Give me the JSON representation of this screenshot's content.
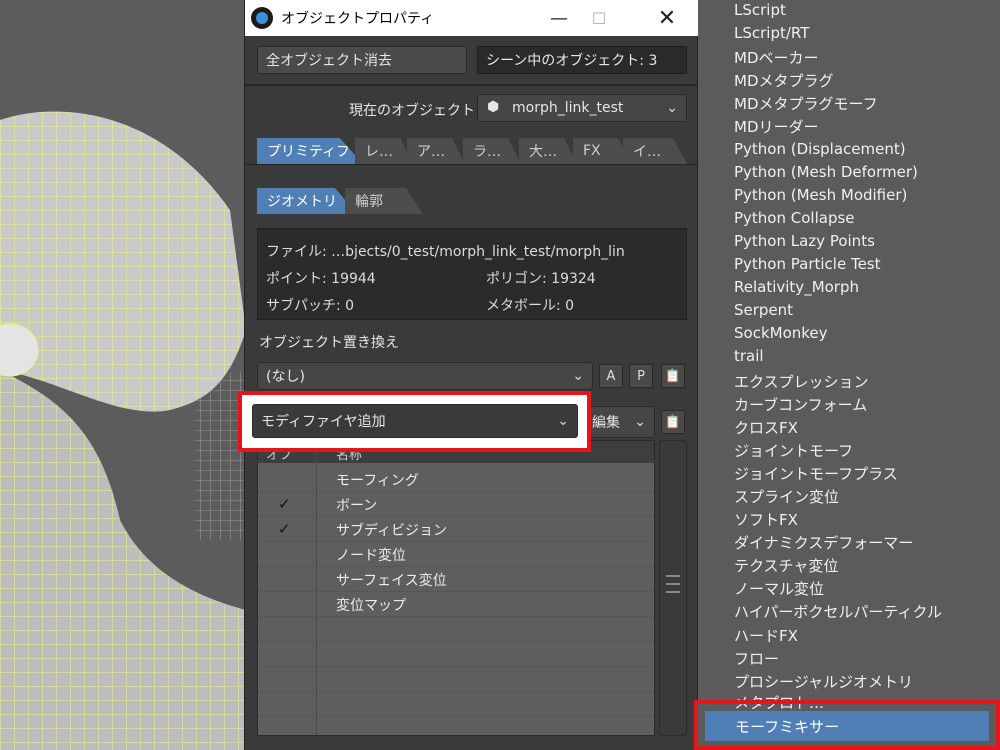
{
  "window": {
    "title": "オブジェクトプロパティ",
    "minimize": "—",
    "maximize": "☐",
    "close": "✕"
  },
  "top": {
    "clear_button": "全オブジェクト消去",
    "scene_objects": "シーン中のオブジェクト: 3",
    "current_label": "現在のオブジェクト",
    "current_value": "morph_link_test"
  },
  "tabs": [
    "プリミティブ",
    "レ…",
    "ア…",
    "ラ…",
    "大…",
    "FX",
    "イ…"
  ],
  "subtabs": [
    "ジオメトリ",
    "輪郭"
  ],
  "info": {
    "file": "ファイル: …bjects/0_test/morph_link_test/morph_lin",
    "points": "ポイント: 19944",
    "polygons": "ポリゴン: 19324",
    "subpatch": "サブパッチ: 0",
    "metaballs": "メタボール: 0"
  },
  "replace": {
    "label": "オブジェクト置き換え",
    "value": "(なし)",
    "btn_a": "A",
    "btn_p": "P"
  },
  "modifier": {
    "add_label": "モディファイヤ追加",
    "edit_label": "編集"
  },
  "list": {
    "col_on": "オフ",
    "col_name": "名称",
    "rows": [
      {
        "checked": "",
        "name": "モーフィング"
      },
      {
        "checked": "✓",
        "name": "ボーン"
      },
      {
        "checked": "✓",
        "name": "サブディビジョン"
      },
      {
        "checked": "",
        "name": "ノード変位"
      },
      {
        "checked": "",
        "name": "サーフェイス変位"
      },
      {
        "checked": "",
        "name": "変位マップ"
      },
      {
        "checked": "",
        "name": ""
      },
      {
        "checked": "",
        "name": ""
      },
      {
        "checked": "",
        "name": ""
      },
      {
        "checked": "",
        "name": ""
      }
    ]
  },
  "menu": {
    "items": [
      "LScript",
      "LScript/RT",
      "MDベーカー",
      "MDメタプラグ",
      "MDメタプラグモーフ",
      "MDリーダー",
      "Python (Displacement)",
      "Python (Mesh Deformer)",
      "Python (Mesh Modifier)",
      "Python Collapse",
      "Python Lazy Points",
      "Python Particle Test",
      "Relativity_Morph",
      "Serpent",
      "SockMonkey",
      "trail",
      "エクスプレッション",
      "カーブコンフォーム",
      "クロスFX",
      "ジョイントモーフ",
      "ジョイントモーフプラス",
      "スプライン変位",
      "ソフトFX",
      "ダイナミクスデフォーマー",
      "テクスチャ変位",
      "ノーマル変位",
      "ハイパーボクセルパーティクル",
      "ハードFX",
      "フロー",
      "プロシージャルジオメトリ",
      "メタプロト…"
    ],
    "selected": "モーフミキサー"
  },
  "colors": {
    "highlight": "#e8141b",
    "accent": "#4f7fb5",
    "wire": "#f2ef86"
  }
}
